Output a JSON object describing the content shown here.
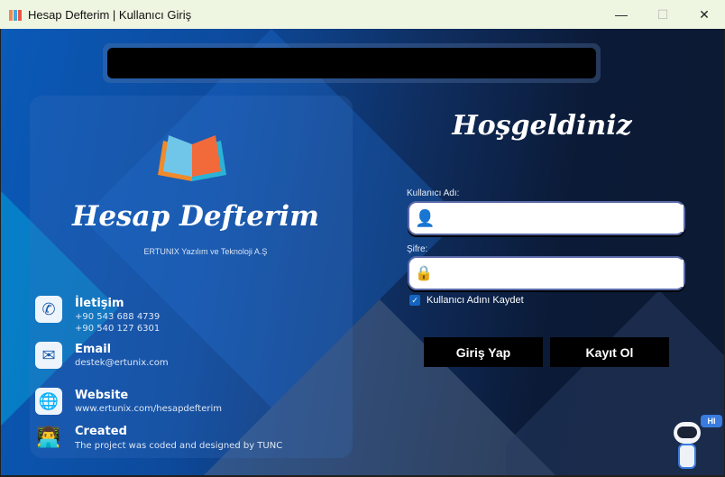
{
  "window": {
    "title": "Hesap Defterim | Kullanıcı Giriş",
    "minimize": "—",
    "maximize": "☐",
    "close": "✕"
  },
  "left": {
    "brand": "Hesap Defterim",
    "company": "ERTUNIX Yazılım ve Teknoloji A.Ş",
    "contact": {
      "heading": "İletişim",
      "phone1": "+90 543 688 4739",
      "phone2": "+90 540 127 6301"
    },
    "email": {
      "heading": "Email",
      "value": "destek@ertunix.com"
    },
    "website": {
      "heading": "Website",
      "value": "www.ertunix.com/hesapdefterim"
    },
    "created": {
      "heading": "Created",
      "value": "The project was coded and designed by TUNC"
    }
  },
  "login": {
    "welcome": "Hoşgeldiniz",
    "username_label": "Kullanıcı Adı:",
    "username_value": "",
    "password_label": "Şifre:",
    "password_value": "",
    "remember_label": "Kullanıcı Adını Kaydet",
    "remember_checked": true,
    "login_button": "Giriş Yap",
    "register_button": "Kayıt Ol"
  },
  "robot": {
    "bubble": "HI"
  }
}
